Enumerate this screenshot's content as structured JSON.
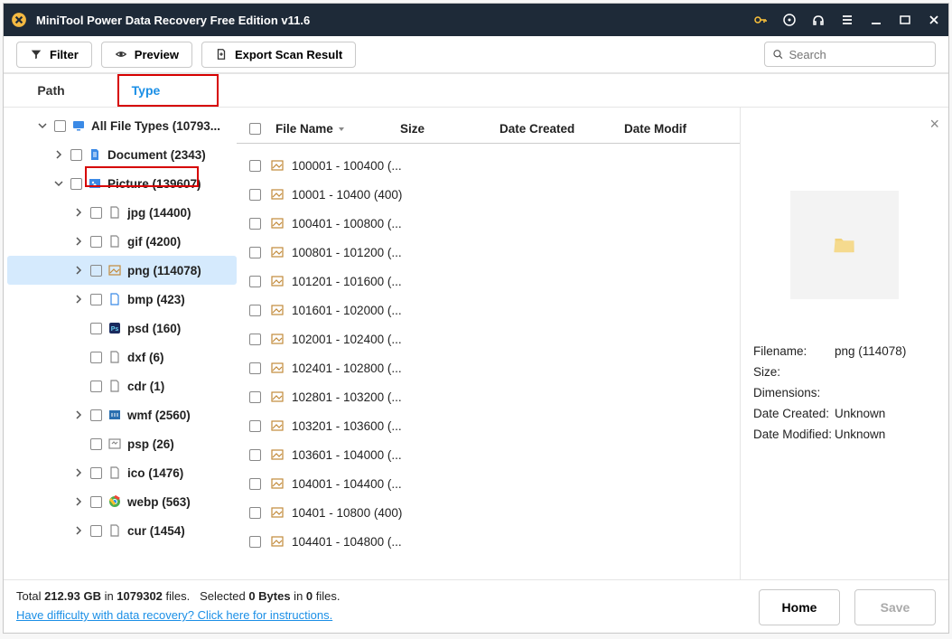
{
  "titlebar": {
    "title": "MiniTool Power Data Recovery Free Edition v11.6"
  },
  "toolbar": {
    "filter": "Filter",
    "preview": "Preview",
    "export": "Export Scan Result",
    "search_placeholder": "Search"
  },
  "tabs": {
    "path": "Path",
    "type": "Type"
  },
  "tree": [
    {
      "pad": 26,
      "chev": "down",
      "label": "All File Types (10793...",
      "icon": "monitor",
      "color": "#3b8ae6"
    },
    {
      "pad": 44,
      "chev": "right",
      "label": "Document (2343)",
      "icon": "doc",
      "color": "#3b8ae6"
    },
    {
      "pad": 44,
      "chev": "down",
      "label": "Picture (139607)",
      "icon": "pic",
      "color": "#3b8ae6"
    },
    {
      "pad": 66,
      "chev": "right",
      "label": "jpg (14400)",
      "icon": "file",
      "color": "#888"
    },
    {
      "pad": 66,
      "chev": "right",
      "label": "gif (4200)",
      "icon": "file",
      "color": "#888"
    },
    {
      "pad": 66,
      "chev": "right",
      "label": "png (114078)",
      "icon": "img",
      "color": "#c28a3a",
      "sel": true
    },
    {
      "pad": 66,
      "chev": "right",
      "label": "bmp (423)",
      "icon": "file",
      "color": "#3b8ae6"
    },
    {
      "pad": 66,
      "chev": "",
      "label": "psd (160)",
      "icon": "ps",
      "color": "#1a2a5e"
    },
    {
      "pad": 66,
      "chev": "",
      "label": "dxf (6)",
      "icon": "file",
      "color": "#888"
    },
    {
      "pad": 66,
      "chev": "",
      "label": "cdr (1)",
      "icon": "file",
      "color": "#888"
    },
    {
      "pad": 66,
      "chev": "right",
      "label": "wmf (2560)",
      "icon": "wm",
      "color": "#2a6fb0"
    },
    {
      "pad": 66,
      "chev": "",
      "label": "psp (26)",
      "icon": "psp",
      "color": "#888"
    },
    {
      "pad": 66,
      "chev": "right",
      "label": "ico (1476)",
      "icon": "file",
      "color": "#888"
    },
    {
      "pad": 66,
      "chev": "right",
      "label": "webp (563)",
      "icon": "chrome",
      "color": "#4caf50"
    },
    {
      "pad": 66,
      "chev": "right",
      "label": "cur (1454)",
      "icon": "file",
      "color": "#888"
    }
  ],
  "columns": {
    "name": "File Name",
    "size": "Size",
    "created": "Date Created",
    "modified": "Date Modif"
  },
  "files": [
    {
      "name": "100001 - 100400 (..."
    },
    {
      "name": "10001 - 10400 (400)"
    },
    {
      "name": "100401 - 100800 (..."
    },
    {
      "name": "100801 - 101200 (..."
    },
    {
      "name": "101201 - 101600 (..."
    },
    {
      "name": "101601 - 102000 (..."
    },
    {
      "name": "102001 - 102400 (..."
    },
    {
      "name": "102401 - 102800 (..."
    },
    {
      "name": "102801 - 103200 (..."
    },
    {
      "name": "103201 - 103600 (..."
    },
    {
      "name": "103601 - 104000 (..."
    },
    {
      "name": "104001 - 104400 (..."
    },
    {
      "name": "10401 - 10800 (400)"
    },
    {
      "name": "104401 - 104800 (..."
    }
  ],
  "preview": {
    "filename_label": "Filename:",
    "filename_value": "png (114078)",
    "size_label": "Size:",
    "size_value": "",
    "dim_label": "Dimensions:",
    "dim_value": "",
    "created_label": "Date Created:",
    "created_value": "Unknown",
    "modified_label": "Date Modified:",
    "modified_value": "Unknown"
  },
  "footer": {
    "total1": "Total ",
    "total_size": "212.93 GB",
    "total2": " in ",
    "total_files": "1079302",
    "total3": " files.",
    "sel1": "Selected ",
    "sel_bytes": "0 Bytes",
    "sel2": " in ",
    "sel_files": "0",
    "sel3": " files.",
    "help": "Have difficulty with data recovery? Click here for instructions.",
    "home": "Home",
    "save": "Save"
  }
}
